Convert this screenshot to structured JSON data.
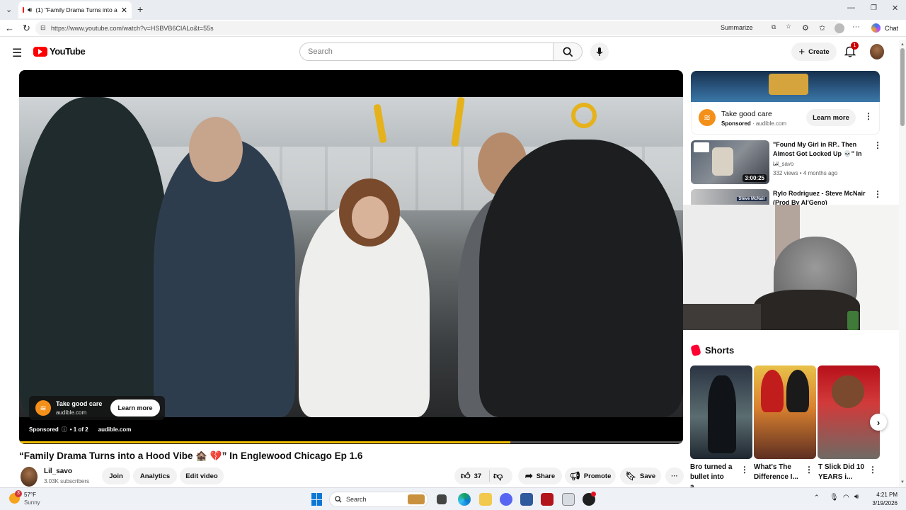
{
  "browser": {
    "tab_title": "(1) \"Family Drama Turns into a",
    "url": "https://www.youtube.com/watch?v=HSBVB6CIALo&t=55s",
    "summarize_label": "Summarize",
    "chat_label": "Chat"
  },
  "youtube": {
    "logo_text": "YouTube",
    "search_placeholder": "Search",
    "create_label": "Create",
    "notification_count": "1"
  },
  "player": {
    "ad_title": "Take good care",
    "ad_domain": "audible.com",
    "ad_button": "Learn more",
    "sponsored_label": "Sponsored",
    "ad_count": "• 1 of 2",
    "ad_domain_bottom": "audible.com",
    "progress_fraction": 0.74
  },
  "video": {
    "title": "“Family Drama Turns into a Hood Vibe 🏚️ 💔” In Englewood Chicago Ep 1.6",
    "channel_name": "Lil_savo",
    "subscribers": "3.03K subscribers",
    "join_label": "Join",
    "analytics_label": "Analytics",
    "edit_label": "Edit video",
    "likes": "37",
    "share_label": "Share",
    "promote_label": "Promote",
    "save_label": "Save"
  },
  "sidebar": {
    "ad": {
      "title": "Take good care",
      "sponsored": "Sponsored",
      "domain": "audible.com",
      "button": "Learn more"
    },
    "videos": [
      {
        "title": "\"Found My Girl in RP.. Then Almost Got Locked Up 💀\" In ...",
        "channel": "Lil_savo",
        "meta": "332 views • 4 months ago",
        "duration": "3:00:25"
      },
      {
        "title": "Rylo Rodriguez - Steve McNair (Prod By Al'Geno)",
        "thumb_text": "Steve McNair"
      }
    ],
    "shorts_label": "Shorts",
    "shorts": [
      {
        "title": "Bro turned a bullet into a..."
      },
      {
        "title": "What's The Difference I..."
      },
      {
        "title": "T Slick Did 10 YEARS i..."
      }
    ]
  },
  "taskbar": {
    "weather_temp": "57°F",
    "weather_desc": "Sunny",
    "weather_badge": "3",
    "search_label": "Search",
    "time": "4:21 PM",
    "date": "3/19/2026"
  },
  "colors": {
    "youtube_red": "#ff0000",
    "ad_progress": "#f2c200",
    "audible_orange": "#f39019",
    "edge_blue": "#0c78d6"
  }
}
